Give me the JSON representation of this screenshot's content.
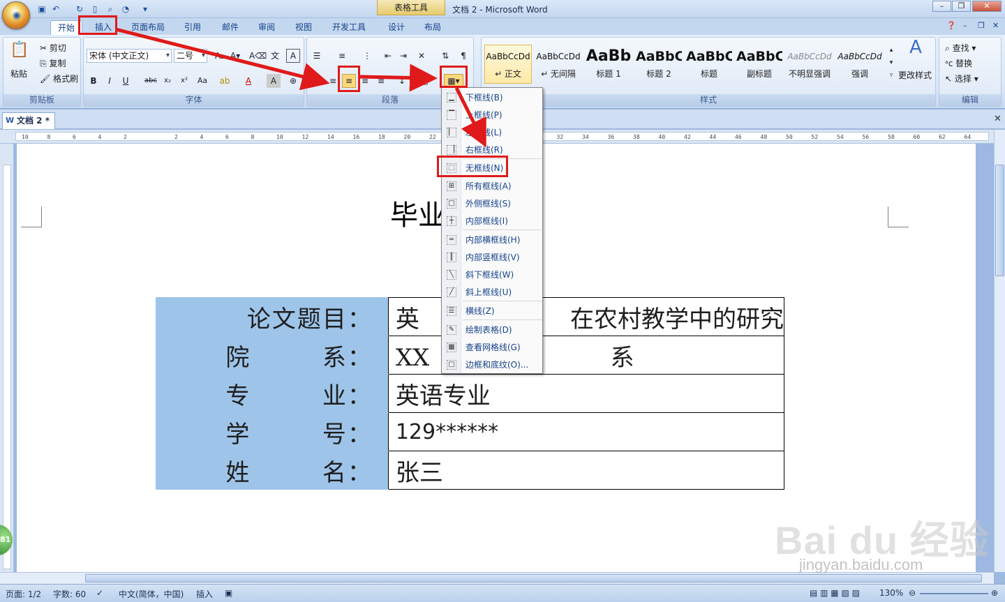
{
  "window": {
    "title": "文档 2 - Microsoft Word",
    "contextual_tool": "表格工具"
  },
  "tabs": [
    "开始",
    "插入",
    "页面布局",
    "引用",
    "邮件",
    "审阅",
    "视图",
    "开发工具",
    "设计",
    "布局"
  ],
  "clipboard": {
    "paste": "粘贴",
    "cut": "剪切",
    "copy": "复制",
    "format_painter": "格式刷",
    "label": "剪贴板"
  },
  "font": {
    "name": "宋体 (中文正文)",
    "size": "二号",
    "label": "字体"
  },
  "paragraph": {
    "label": "段落"
  },
  "styles": {
    "label": "样式",
    "change_styles": "更改样式",
    "items": [
      {
        "sample": "AaBbCcDd",
        "name": "↵ 正文"
      },
      {
        "sample": "AaBbCcDd",
        "name": "↵ 无间隔"
      },
      {
        "sample": "AaBb",
        "name": "标题 1"
      },
      {
        "sample": "AaBbC",
        "name": "标题 2"
      },
      {
        "sample": "AaBbC",
        "name": "标题"
      },
      {
        "sample": "AaBbC",
        "name": "副标题"
      },
      {
        "sample": "AaBbCcDd",
        "name": "不明显强调"
      },
      {
        "sample": "AaBbCcDd",
        "name": "强调"
      }
    ]
  },
  "editing": {
    "label": "编辑",
    "find": "查找",
    "replace": "替换",
    "select": "选择"
  },
  "doc_tab": "文档 2 *",
  "document": {
    "title": "毕业",
    "rows": [
      {
        "label": "论文题目：",
        "value": "英                    在农村教学中的研究"
      },
      {
        "label": "院        系：",
        "value": "XX                        系"
      },
      {
        "label": "专        业：",
        "value": "英语专业"
      },
      {
        "label": "学        号：",
        "value": "129******"
      },
      {
        "label": "姓        名：",
        "value": "张三"
      }
    ]
  },
  "border_menu": [
    "下框线(B)",
    "上框线(P)",
    "左框线(L)",
    "右框线(R)",
    "无框线(N)",
    "所有框线(A)",
    "外侧框线(S)",
    "内部框线(I)",
    "内部横框线(H)",
    "内部竖框线(V)",
    "斜下框线(W)",
    "斜上框线(U)",
    "横线(Z)",
    "绘制表格(D)",
    "查看网格线(G)",
    "边框和底纹(O)..."
  ],
  "status": {
    "page": "页面: 1/2",
    "words": "字数: 60",
    "language": "中文(简体，中国)",
    "mode": "插入",
    "zoom": "130%"
  },
  "watermark": {
    "logo": "Bai du 经验",
    "url": "jingyan.baidu.com"
  },
  "badge": "81",
  "colors": {
    "annotation_red": "#e01a1a",
    "label_cell_bg": "#9ec4e9"
  }
}
